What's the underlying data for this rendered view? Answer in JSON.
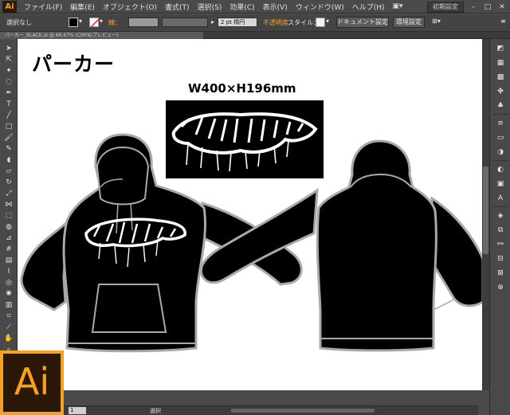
{
  "app": {
    "logo_text": "Ai",
    "menu": [
      "ファイル(F)",
      "編集(E)",
      "オブジェクト(O)",
      "書式(T)",
      "選択(S)",
      "効果(C)",
      "表示(V)",
      "ウィンドウ(W)",
      "ヘルプ(H)"
    ],
    "workspace_preset": "初期設定",
    "accent_color": "#f7a21b"
  },
  "control_bar": {
    "selection_state": "選択なし",
    "stroke_label": "線：",
    "stroke_weight": "2 pt 楕円",
    "opacity_label": "不透明度",
    "style_label": "スタイル：",
    "doc_settings_button": "ドキュメント設定",
    "preferences_button": "環境設定"
  },
  "document_tab": {
    "title": "パーカー_BLACK.ai @ 66.67% (CMYK/プレビュー)"
  },
  "artboard": {
    "heading": "パーカー",
    "print_size": "W400×H196mm",
    "garment_color": "#000000",
    "outline_color": "#a9a9a9"
  },
  "status_bar": {
    "zoom": "1",
    "current_tool": "選択"
  },
  "badge": {
    "text": "Ai"
  }
}
